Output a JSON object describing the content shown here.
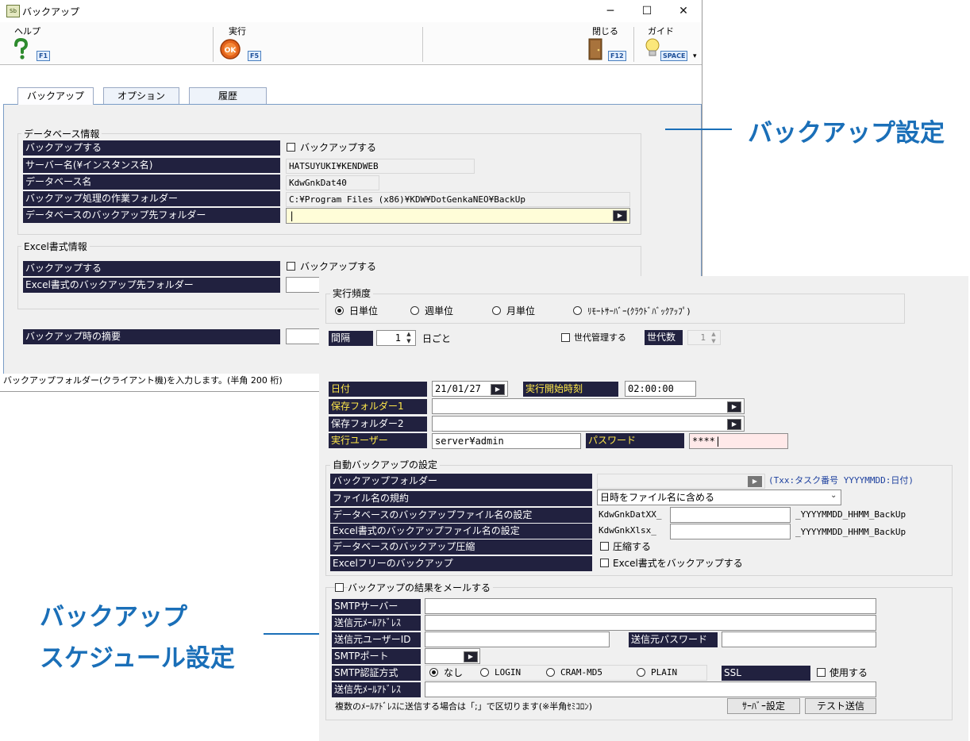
{
  "window": {
    "title": "バックアップ",
    "app_icon": "app-icon",
    "controls": {
      "minimize": "─",
      "maximize": "☐",
      "close": "✕"
    }
  },
  "toolbar": {
    "help": {
      "label": "ヘルプ",
      "key": "F1",
      "icon": "question-icon"
    },
    "run": {
      "label": "実行",
      "key": "F5",
      "icon": "ok-icon"
    },
    "close": {
      "label": "閉じる",
      "key": "F12",
      "icon": "door-icon"
    },
    "guide": {
      "label": "ガイド",
      "key": "SPACE",
      "icon": "lightbulb-icon"
    },
    "overflow": "▾"
  },
  "tabs": [
    {
      "label": "バックアップ",
      "active": true
    },
    {
      "label": "オプション",
      "active": false
    },
    {
      "label": "履歴",
      "active": false
    }
  ],
  "database_info": {
    "group_title": "データベース情報",
    "rows": [
      {
        "label": "バックアップする",
        "checkbox_label": "バックアップする"
      },
      {
        "label": "サーバー名(¥インスタンス名)",
        "value": "HATSUYUKI¥KENDWEB"
      },
      {
        "label": "データベース名",
        "value": "KdwGnkDat40"
      },
      {
        "label": "バックアップ処理の作業フォルダー",
        "value": "C:¥Program Files (x86)¥KDW¥DotGenkaNEO¥BackUp"
      },
      {
        "label": "データベースのバックアップ先フォルダー",
        "value": "|"
      }
    ]
  },
  "excel_info": {
    "group_title": "Excel書式情報",
    "rows": [
      {
        "label": "バックアップする",
        "checkbox_label": "バックアップする"
      },
      {
        "label": "Excel書式のバックアップ先フォルダー",
        "value": ""
      }
    ]
  },
  "summary": {
    "label": "バックアップ時の摘要",
    "value": ""
  },
  "status_bar": "バックアップフォルダー(クライアント機)を入力します。(半角 200 桁)",
  "callouts": {
    "backup_settings": "バックアップ設定",
    "schedule_line1": "バックアップ",
    "schedule_line2": "スケジュール設定",
    "color": "#1a6fb8"
  },
  "schedule": {
    "frequency_title": "実行頻度",
    "frequency_options": [
      "日単位",
      "週単位",
      "月単位",
      "ﾘﾓｰﾄｻｰﾊﾞｰ(ｸﾗｳﾄﾞﾊﾞｯｸｱｯﾌﾟ)"
    ],
    "frequency_selected": "日単位",
    "interval_label": "間隔",
    "interval_value": "1",
    "interval_suffix": "日ごと",
    "generation_check": "世代管理する",
    "generation_label": "世代数",
    "generation_value": "1",
    "date_label": "日付",
    "date_value": "21/01/27",
    "start_time_label": "実行開始時刻",
    "start_time_value": "02:00:00",
    "save_folder1_label": "保存フォルダー1",
    "save_folder1_value": "",
    "save_folder2_label": "保存フォルダー2",
    "save_folder2_value": "",
    "user_label": "実行ユーザー",
    "user_value": "server¥admin",
    "password_label": "パスワード",
    "password_value": "****|"
  },
  "auto_backup": {
    "group_title": "自動バックアップの設定",
    "folder_label": "バックアップフォルダー",
    "folder_value": "",
    "folder_hint": "(Txx:タスク番号 YYYYMMDD:日付)",
    "naming_label": "ファイル名の規約",
    "naming_value": "日時をファイル名に含める",
    "db_filename_label": "データベースのバックアップファイル名の設定",
    "db_filename_prefix": "KdwGnkDatXX_",
    "db_filename_value": "",
    "db_filename_suffix": "_YYYYMMDD_HHMM_BackUp",
    "excel_filename_label": "Excel書式のバックアップファイル名の設定",
    "excel_filename_prefix": "KdwGnkXlsx_",
    "excel_filename_value": "",
    "excel_filename_suffix": "_YYYYMMDD_HHMM_BackUp",
    "compress_label": "データベースのバックアップ圧縮",
    "compress_check": "圧縮する",
    "excel_free_label": "Excelフリーのバックアップ",
    "excel_free_check": "Excel書式をバックアップする"
  },
  "mail": {
    "group_check": "バックアップの結果をメールする",
    "smtp_server_label": "SMTPサーバー",
    "smtp_server_value": "",
    "from_address_label": "送信元ﾒｰﾙｱﾄﾞﾚｽ",
    "from_address_value": "",
    "from_user_label": "送信元ユーザーID",
    "from_user_value": "",
    "from_password_label": "送信元パスワード",
    "from_password_value": "",
    "smtp_port_label": "SMTPポート",
    "smtp_port_value": "",
    "auth_label": "SMTP認証方式",
    "auth_options": [
      "なし",
      "LOGIN",
      "CRAM-MD5",
      "PLAIN"
    ],
    "auth_selected": "なし",
    "ssl_label": "SSL",
    "ssl_check": "使用する",
    "to_address_label": "送信先ﾒｰﾙｱﾄﾞﾚｽ",
    "to_address_value": "",
    "note": "複数のﾒｰﾙｱﾄﾞﾚｽに送信する場合は「;」で区切ります(※半角ｾﾐｺﾛﾝ)",
    "server_settings_button": "ｻｰﾊﾞｰ設定",
    "test_send_button": "テスト送信"
  }
}
